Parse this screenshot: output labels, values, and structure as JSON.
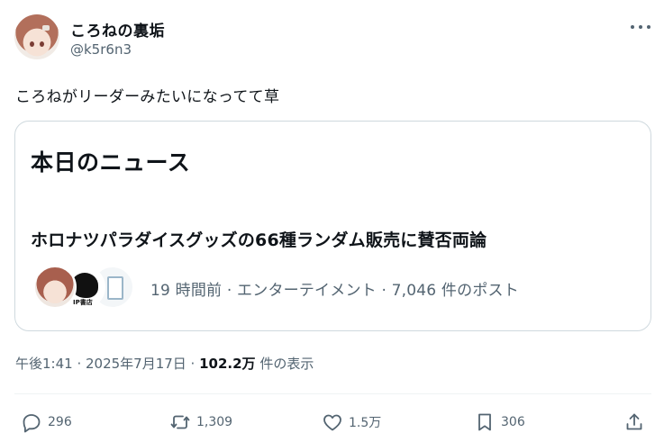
{
  "author": {
    "display_name": "ころねの裏垢",
    "handle": "@k5r6n3",
    "avatar_icon": "avatar-icon"
  },
  "tweet": {
    "text": "ころねがリーダーみたいになってて草"
  },
  "card": {
    "heading": "本日のニュース",
    "headline": "ホロナツパラダイスグッズの66種ランダム販売に賛否両論",
    "meta": "19 時間前 · エンターテイメント · 7,046 件のポスト",
    "facepile": [
      "avatar-icon",
      "publisher-logo-icon",
      "milk-carton-icon"
    ],
    "publisher_tag": "IP書店"
  },
  "timestamp": {
    "time_date": "午後1:41 · 2025年7月17日 · ",
    "views_count": "102.2万",
    "views_label": " 件の表示"
  },
  "actions": {
    "replies": "296",
    "reposts": "1,309",
    "likes": "1.5万",
    "bookmarks": "306"
  },
  "colors": {
    "text": "#0f1419",
    "secondary": "#536471",
    "border": "#cfd9de"
  }
}
